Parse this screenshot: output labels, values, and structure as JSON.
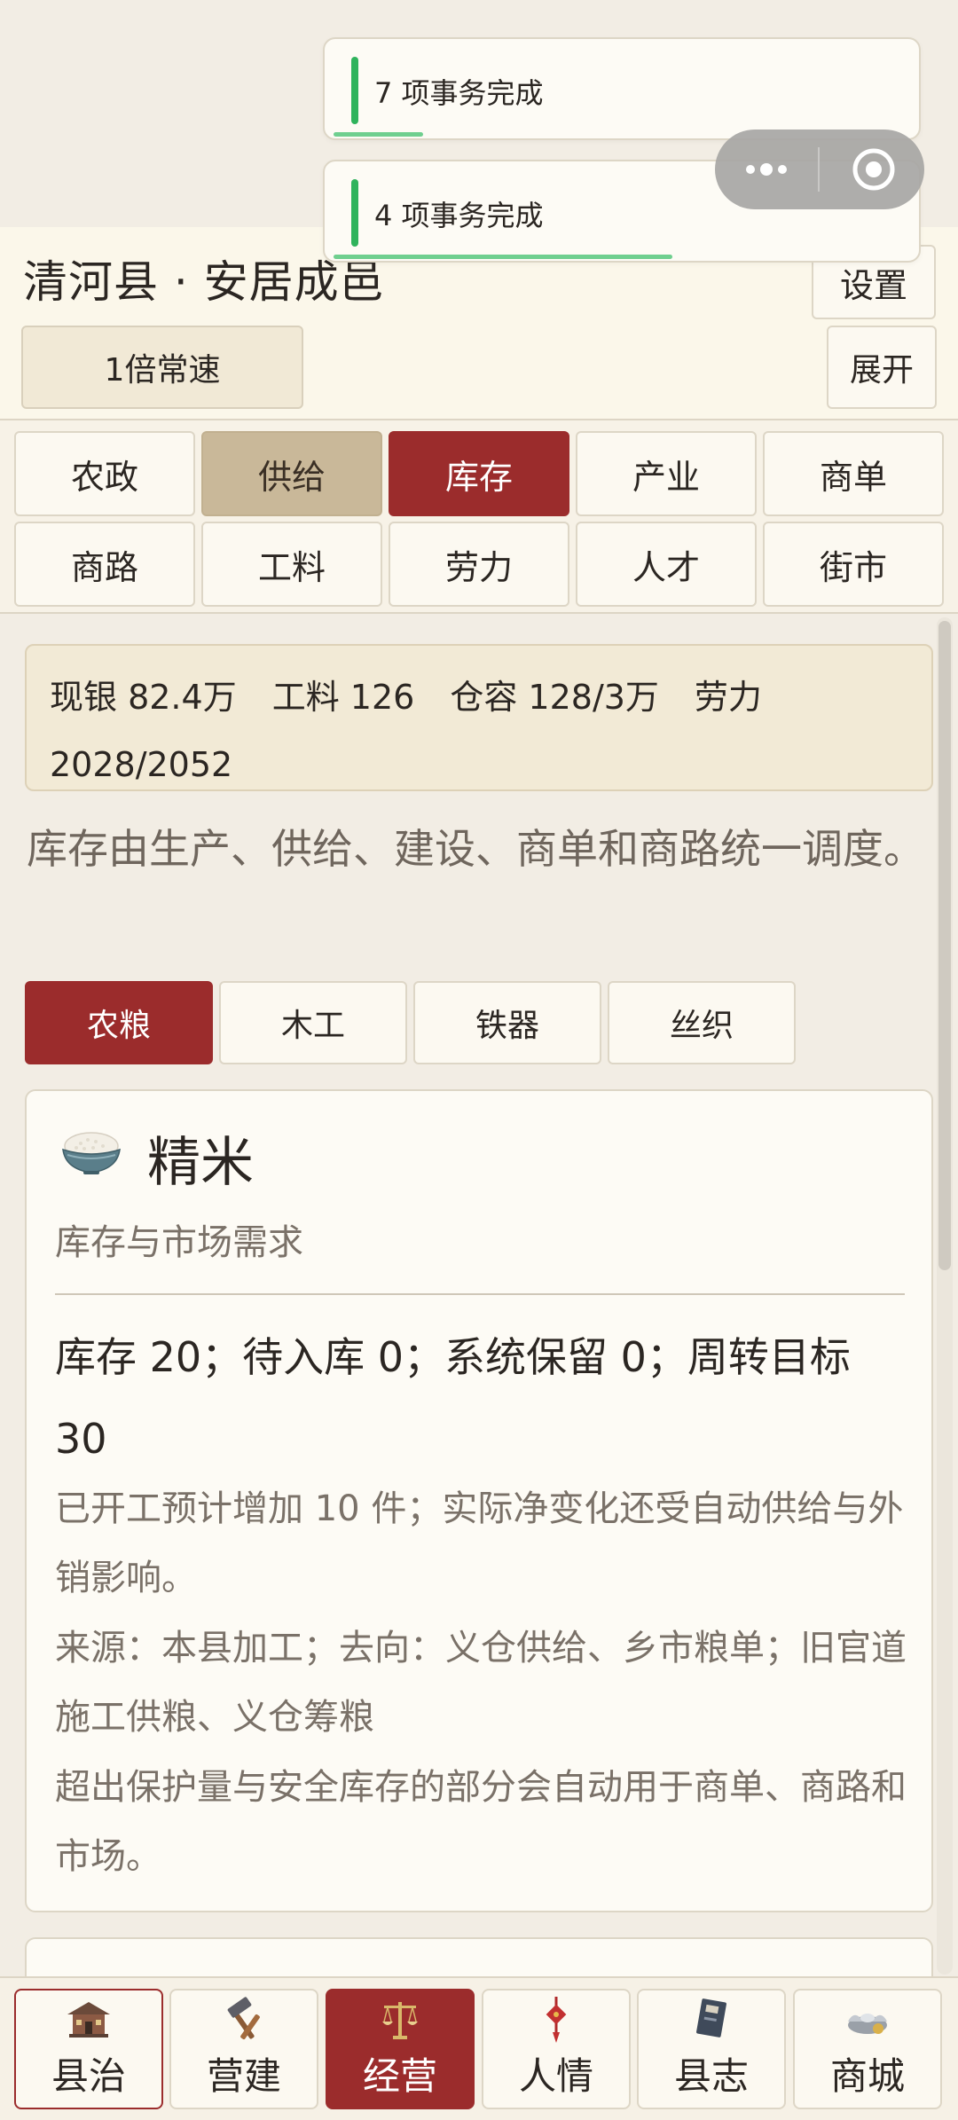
{
  "header": {
    "title": "清河县 · 安居成邑",
    "settings_label": "设置",
    "speed_label": "1倍常速",
    "expand_label": "展开"
  },
  "tabs": [
    {
      "label": "农政",
      "state": "normal"
    },
    {
      "label": "供给",
      "state": "tan"
    },
    {
      "label": "库存",
      "state": "active"
    },
    {
      "label": "产业",
      "state": "normal"
    },
    {
      "label": "商单",
      "state": "normal"
    },
    {
      "label": "商路",
      "state": "normal"
    },
    {
      "label": "工料",
      "state": "normal"
    },
    {
      "label": "劳力",
      "state": "normal"
    },
    {
      "label": "人才",
      "state": "normal"
    },
    {
      "label": "街市",
      "state": "normal"
    }
  ],
  "resources": {
    "silver": "现银 82.4万",
    "materials": "工料 126",
    "storage": "仓容 128/3万",
    "labor_label": "劳力",
    "labor_value": "2028/2052"
  },
  "description": "库存由生产、供给、建设、商单和商路统一调度。",
  "subtabs": [
    {
      "label": "农粮",
      "active": true
    },
    {
      "label": "木工",
      "active": false
    },
    {
      "label": "铁器",
      "active": false
    },
    {
      "label": "丝织",
      "active": false
    }
  ],
  "item": {
    "icon": "rice-bowl-icon",
    "name": "精米",
    "subtitle": "库存与市场需求",
    "stock_line": "库存 20；待入库 0；系统保留 0；周转目标 30",
    "para1": "已开工预计增加 10 件；实际净变化还受自动供给与外销影响。",
    "para2": "来源：本县加工；去向：义仓供给、乡市粮单；旧官道施工供粮、义仓筹粮",
    "para3": "超出保护量与安全库存的部分会自动用于商单、商路和市场。"
  },
  "bottom_nav": [
    {
      "label": "县治",
      "icon": "county-hall-icon",
      "state": "outlined"
    },
    {
      "label": "营建",
      "icon": "hammer-icon",
      "state": "normal"
    },
    {
      "label": "经营",
      "icon": "scales-icon",
      "state": "active"
    },
    {
      "label": "人情",
      "icon": "chinese-knot-icon",
      "state": "normal"
    },
    {
      "label": "县志",
      "icon": "book-icon",
      "state": "normal"
    },
    {
      "label": "商城",
      "icon": "ingot-icon",
      "state": "normal"
    }
  ],
  "toasts": [
    {
      "text": "7 项事务完成",
      "progress": 0.15
    },
    {
      "text": "4 项事务完成",
      "progress": 0.57
    }
  ],
  "colors": {
    "accent_red": "#9b2c2c",
    "tan": "#c9b899",
    "success_green": "#2fb35c"
  }
}
